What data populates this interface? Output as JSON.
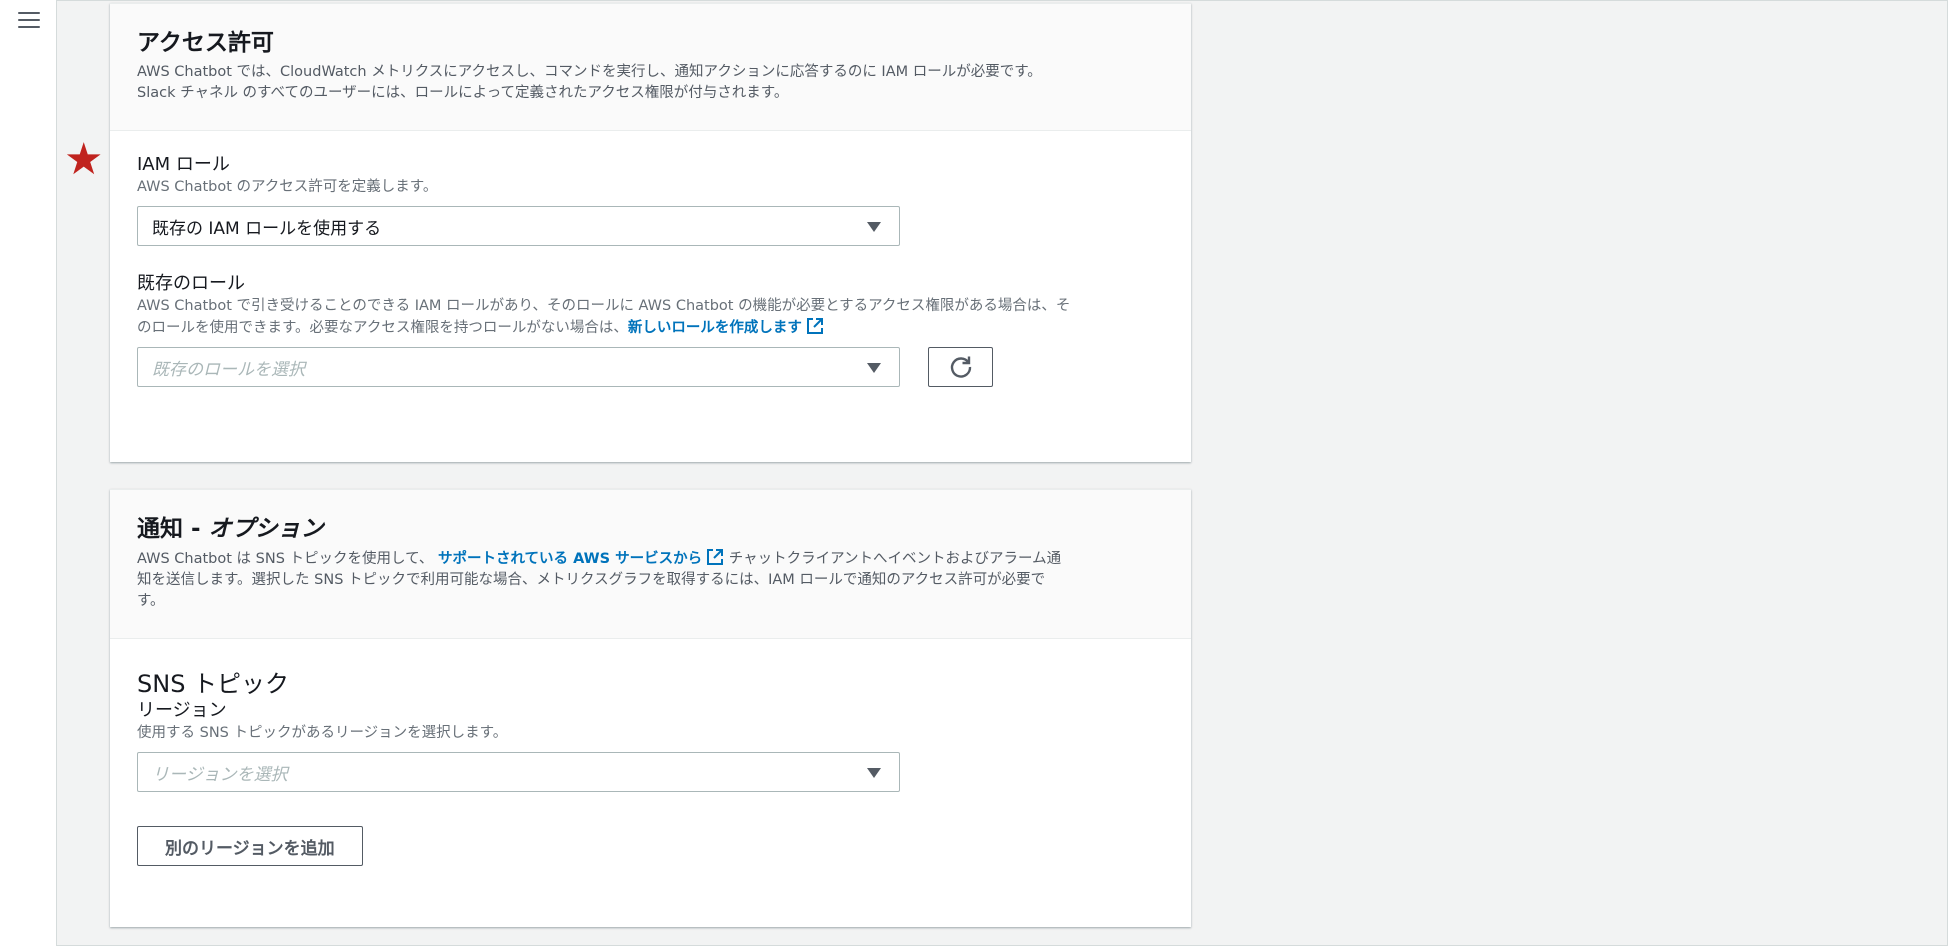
{
  "access": {
    "title": "アクセス許可",
    "desc_line1": "AWS Chatbot では、CloudWatch メトリクスにアクセスし、コマンドを実行し、通知アクションに応答するのに IAM ロールが必要です。",
    "desc_line2": "Slack チャネル のすべてのユーザーには、ロールによって定義されたアクセス権限が付与されます。",
    "iam_role_label": "IAM ロール",
    "iam_role_desc": "AWS Chatbot のアクセス許可を定義します。",
    "iam_role_value": "既存の IAM ロールを使用する",
    "existing_role_label": "既存のロール",
    "existing_role_desc_line1": "AWS Chatbot で引き受けることのできる IAM ロールがあり、そのロールに AWS Chatbot の機能が必要とするアクセス権限がある場合は、そ",
    "existing_role_desc_line2": "のロールを使用できます。必要なアクセス権限を持つロールがない場合は、",
    "create_role_link": "新しいロールを作成します",
    "existing_role_placeholder": "既存のロールを選択"
  },
  "notify": {
    "title_prefix": "通知 - ",
    "title_italic": "オプション",
    "desc_part1": "AWS Chatbot は SNS トピックを使用して、 ",
    "supported_link": "サポートされている AWS サービスから",
    "desc_part2": " チャットクライアントへイベントおよびアラーム通",
    "desc_line2": "知を送信します。選択した SNS トピックで利用可能な場合、メトリクスグラフを取得するには、IAM ロールで通知のアクセス許可が必要で",
    "desc_line3": "す。",
    "sns_topic_title": "SNS トピック",
    "region_label": "リージョン",
    "region_desc": "使用する SNS トピックがあるリージョンを選択します。",
    "region_placeholder": "リージョンを選択",
    "add_region_button": "別のリージョンを追加"
  },
  "icons": {
    "menu": "hamburger-icon",
    "required": "star-icon",
    "external": "external-link-icon",
    "refresh": "refresh-icon",
    "dropdown": "caret-down-icon"
  },
  "colors": {
    "link": "#0073bb",
    "star": "#c0231e",
    "background": "#f2f3f3"
  }
}
